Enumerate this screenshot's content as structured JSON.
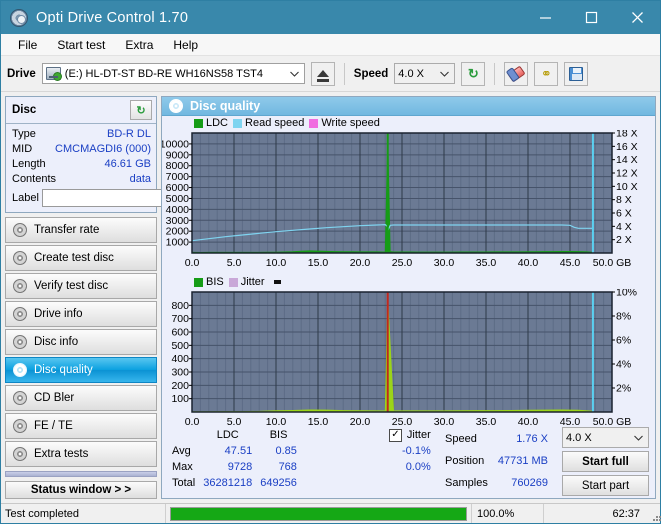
{
  "window": {
    "title": "Opti Drive Control 1.70",
    "app_icon": "disc-icon",
    "minimize": "–",
    "maximize": "□",
    "close": "✕"
  },
  "menu": {
    "items": [
      "File",
      "Start test",
      "Extra",
      "Help"
    ]
  },
  "toolbar": {
    "drive_label": "Drive",
    "drive_value": "(E:)   HL-DT-ST BD-RE  WH16NS58 TST4",
    "eject_title": "Eject",
    "speed_label": "Speed",
    "speed_value": "4.0 X",
    "refresh_glyph": "↻",
    "erase_title": "Erase",
    "scan_title": "Scan",
    "save_title": "Save"
  },
  "disc": {
    "panel_title": "Disc",
    "refresh_glyph": "↻",
    "rows": [
      {
        "key": "Type",
        "value": "BD-R DL"
      },
      {
        "key": "MID",
        "value": "CMCMAGDI6 (000)"
      },
      {
        "key": "Length",
        "value": "46.61 GB"
      },
      {
        "key": "Contents",
        "value": "data"
      }
    ],
    "label_key": "Label",
    "label_value": "",
    "label_placeholder": ""
  },
  "sidebar": {
    "items": [
      {
        "label": "Transfer rate",
        "active": false
      },
      {
        "label": "Create test disc",
        "active": false
      },
      {
        "label": "Verify test disc",
        "active": false
      },
      {
        "label": "Drive info",
        "active": false
      },
      {
        "label": "Disc info",
        "active": false
      },
      {
        "label": "Disc quality",
        "active": true
      },
      {
        "label": "CD Bler",
        "active": false
      },
      {
        "label": "FE / TE",
        "active": false
      },
      {
        "label": "Extra tests",
        "active": false
      }
    ],
    "status_button": "Status window > >"
  },
  "main": {
    "header_title": "Disc quality"
  },
  "chart_data": [
    {
      "type": "line",
      "id": "top-chart",
      "title": "",
      "xlabel": "GB",
      "ylabel": "",
      "xlim": [
        0,
        50
      ],
      "ylim": [
        0,
        10000
      ],
      "y2lim": [
        0,
        18
      ],
      "y2label": "X",
      "grid": true,
      "legend_position": "top-left",
      "legend": [
        {
          "name": "LDC",
          "color": "#169c16"
        },
        {
          "name": "Read speed",
          "color": "#7fd4f0"
        },
        {
          "name": "Write speed",
          "color": "#f06de0"
        }
      ],
      "xticks": [
        "0.0",
        "5.0",
        "10.0",
        "15.0",
        "20.0",
        "25.0",
        "30.0",
        "35.0",
        "40.0",
        "45.0",
        "50.0 GB"
      ],
      "yticks": [
        "10000",
        "9000",
        "8000",
        "7000",
        "6000",
        "5000",
        "4000",
        "3000",
        "2000",
        "1000"
      ],
      "y2ticks": [
        "18 X",
        "16 X",
        "14 X",
        "12 X",
        "10 X",
        "8 X",
        "6 X",
        "4 X",
        "2 X"
      ],
      "series": [
        {
          "name": "LDC",
          "color": "#169c16",
          "type": "area",
          "axis": "left",
          "x": [
            0,
            1,
            2,
            3,
            4,
            5,
            6,
            7,
            8,
            9,
            10,
            11,
            12,
            13,
            14,
            15,
            16,
            17,
            18,
            19,
            20,
            21,
            22,
            23,
            23.3,
            23.6,
            24,
            25,
            26,
            27,
            28,
            29,
            30,
            31,
            32,
            33,
            34,
            35,
            36,
            37,
            38,
            39,
            40,
            41,
            42,
            43,
            44,
            45,
            46,
            47,
            47.7
          ],
          "values": [
            60,
            55,
            58,
            62,
            57,
            60,
            65,
            58,
            62,
            70,
            75,
            90,
            110,
            150,
            185,
            165,
            140,
            120,
            115,
            110,
            105,
            100,
            98,
            95,
            9728,
            120,
            95,
            90,
            88,
            85,
            86,
            84,
            83,
            85,
            88,
            90,
            92,
            95,
            98,
            100,
            102,
            105,
            108,
            112,
            118,
            125,
            130,
            128,
            120,
            100,
            60
          ]
        },
        {
          "name": "Read speed",
          "color": "#7fd4f0",
          "type": "line",
          "axis": "right",
          "x": [
            0,
            2,
            4,
            6,
            8,
            10,
            12,
            14,
            16,
            18,
            20,
            22,
            23,
            23.2,
            23.4,
            23.6,
            24,
            26,
            28,
            30,
            32,
            34,
            36,
            38,
            40,
            42,
            44,
            45,
            45.5,
            46,
            47,
            47.7
          ],
          "values": [
            1.85,
            2.15,
            2.45,
            2.7,
            2.95,
            3.2,
            3.4,
            3.6,
            3.8,
            3.95,
            4.1,
            4.2,
            4.25,
            4.05,
            3.6,
            4.15,
            4.2,
            4.2,
            4.2,
            4.2,
            4.2,
            4.2,
            4.2,
            4.2,
            4.2,
            4.2,
            4.2,
            4.15,
            3.85,
            3.7,
            3.7,
            3.7
          ]
        }
      ],
      "markers": [
        {
          "name": "write-end-marker",
          "x": 23.3,
          "color": "#169c16"
        },
        {
          "name": "position-marker",
          "x": 47.73,
          "color": "#5ad0f0"
        }
      ]
    },
    {
      "type": "line",
      "id": "bottom-chart",
      "title": "",
      "xlabel": "GB",
      "ylabel": "",
      "xlim": [
        0,
        50
      ],
      "ylim": [
        0,
        800
      ],
      "y2lim": [
        0,
        10
      ],
      "y2label": "%",
      "grid": true,
      "legend_position": "top-left",
      "legend": [
        {
          "name": "BIS",
          "color": "#169c16"
        },
        {
          "name": "Jitter",
          "color": "#c9a8d8"
        }
      ],
      "xticks": [
        "0.0",
        "5.0",
        "10.0",
        "15.0",
        "20.0",
        "25.0",
        "30.0",
        "35.0",
        "40.0",
        "45.0",
        "50.0 GB"
      ],
      "yticks": [
        "800",
        "700",
        "600",
        "500",
        "400",
        "300",
        "200",
        "100"
      ],
      "y2ticks": [
        "10%",
        "8%",
        "6%",
        "4%",
        "2%"
      ],
      "series": [
        {
          "name": "BIS",
          "color": "#9bd419",
          "type": "area",
          "axis": "left",
          "x": [
            0,
            2,
            4,
            6,
            8,
            10,
            12,
            14,
            16,
            18,
            20,
            22,
            23,
            23.3,
            24,
            26,
            28,
            30,
            32,
            34,
            36,
            38,
            40,
            42,
            44,
            46,
            47.7
          ],
          "values": [
            2,
            2,
            3,
            3,
            5,
            9,
            11,
            14,
            13,
            10,
            9,
            8,
            8,
            768,
            9,
            8,
            8,
            8,
            9,
            10,
            10,
            11,
            12,
            13,
            14,
            12,
            6
          ]
        }
      ],
      "markers": [
        {
          "name": "write-end-marker",
          "x": 23.3,
          "color": "#c2281e"
        },
        {
          "name": "position-marker",
          "x": 47.73,
          "color": "#5ad0f0"
        }
      ]
    }
  ],
  "stats": {
    "col_headers": [
      "LDC",
      "BIS"
    ],
    "rows": [
      {
        "key": "Avg",
        "ldc": "47.51",
        "bis": "0.85",
        "jitter": "-0.1%"
      },
      {
        "key": "Max",
        "ldc": "9728",
        "bis": "768",
        "jitter": "0.0%"
      },
      {
        "key": "Total",
        "ldc": "36281218",
        "bis": "649256",
        "jitter": ""
      }
    ],
    "jitter_label": "Jitter",
    "jitter_checked": true,
    "jitter_check_glyph": "✓",
    "speed_key": "Speed",
    "speed_value": "1.76 X",
    "position_key": "Position",
    "position_value": "47731 MB",
    "samples_key": "Samples",
    "samples_value": "760269",
    "speed_select": "4.0 X",
    "start_full": "Start full",
    "start_part": "Start part"
  },
  "statusbar": {
    "message": "Test completed",
    "progress_percent": 100.0,
    "progress_text": "100.0%",
    "elapsed": "62:37"
  }
}
